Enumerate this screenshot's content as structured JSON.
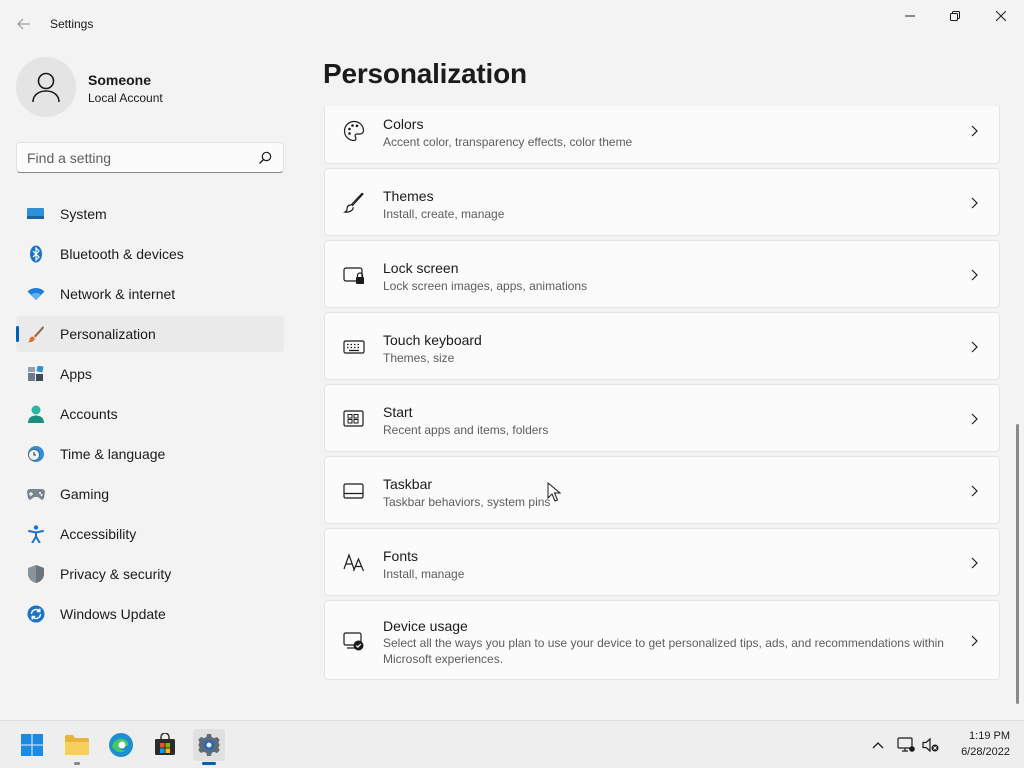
{
  "window": {
    "title": "Settings",
    "back_icon": "back-arrow-icon",
    "controls": [
      "minimize-icon",
      "maximize-icon",
      "close-icon"
    ]
  },
  "profile": {
    "name": "Someone",
    "account_type": "Local Account",
    "avatar_icon": "person-icon"
  },
  "search": {
    "placeholder": "Find a setting",
    "icon": "search-icon"
  },
  "nav": {
    "selected": "Personalization",
    "accent": "#005fb8",
    "items": [
      {
        "label": "System",
        "icon": "monitor-icon"
      },
      {
        "label": "Bluetooth & devices",
        "icon": "bluetooth-icon"
      },
      {
        "label": "Network & internet",
        "icon": "wifi-icon"
      },
      {
        "label": "Personalization",
        "icon": "paintbrush-icon"
      },
      {
        "label": "Apps",
        "icon": "apps-icon"
      },
      {
        "label": "Accounts",
        "icon": "person-icon"
      },
      {
        "label": "Time & language",
        "icon": "clock-globe-icon"
      },
      {
        "label": "Gaming",
        "icon": "gamepad-icon"
      },
      {
        "label": "Accessibility",
        "icon": "accessibility-icon"
      },
      {
        "label": "Privacy & security",
        "icon": "shield-icon"
      },
      {
        "label": "Windows Update",
        "icon": "update-icon"
      }
    ]
  },
  "main": {
    "title": "Personalization",
    "cards": [
      {
        "title": "Colors",
        "desc": "Accent color, transparency effects, color theme",
        "icon": "palette-icon"
      },
      {
        "title": "Themes",
        "desc": "Install, create, manage",
        "icon": "brush-icon"
      },
      {
        "title": "Lock screen",
        "desc": "Lock screen images, apps, animations",
        "icon": "lock-screen-icon"
      },
      {
        "title": "Touch keyboard",
        "desc": "Themes, size",
        "icon": "keyboard-icon"
      },
      {
        "title": "Start",
        "desc": "Recent apps and items, folders",
        "icon": "start-icon"
      },
      {
        "title": "Taskbar",
        "desc": "Taskbar behaviors, system pins",
        "icon": "taskbar-icon"
      },
      {
        "title": "Fonts",
        "desc": "Install, manage",
        "icon": "fonts-icon"
      },
      {
        "title": "Device usage",
        "desc": "Select all the ways you plan to use your device to get personalized tips, ads, and recommendations within Microsoft experiences.",
        "icon": "device-usage-icon"
      }
    ]
  },
  "taskbar": {
    "apps": [
      "windows-start-icon",
      "file-explorer-icon",
      "edge-icon",
      "store-icon",
      "settings-gear-icon"
    ],
    "tray": [
      "chevron-up-icon",
      "network-icon",
      "volume-muted-icon"
    ],
    "time": "1:19 PM",
    "date": "6/28/2022"
  }
}
